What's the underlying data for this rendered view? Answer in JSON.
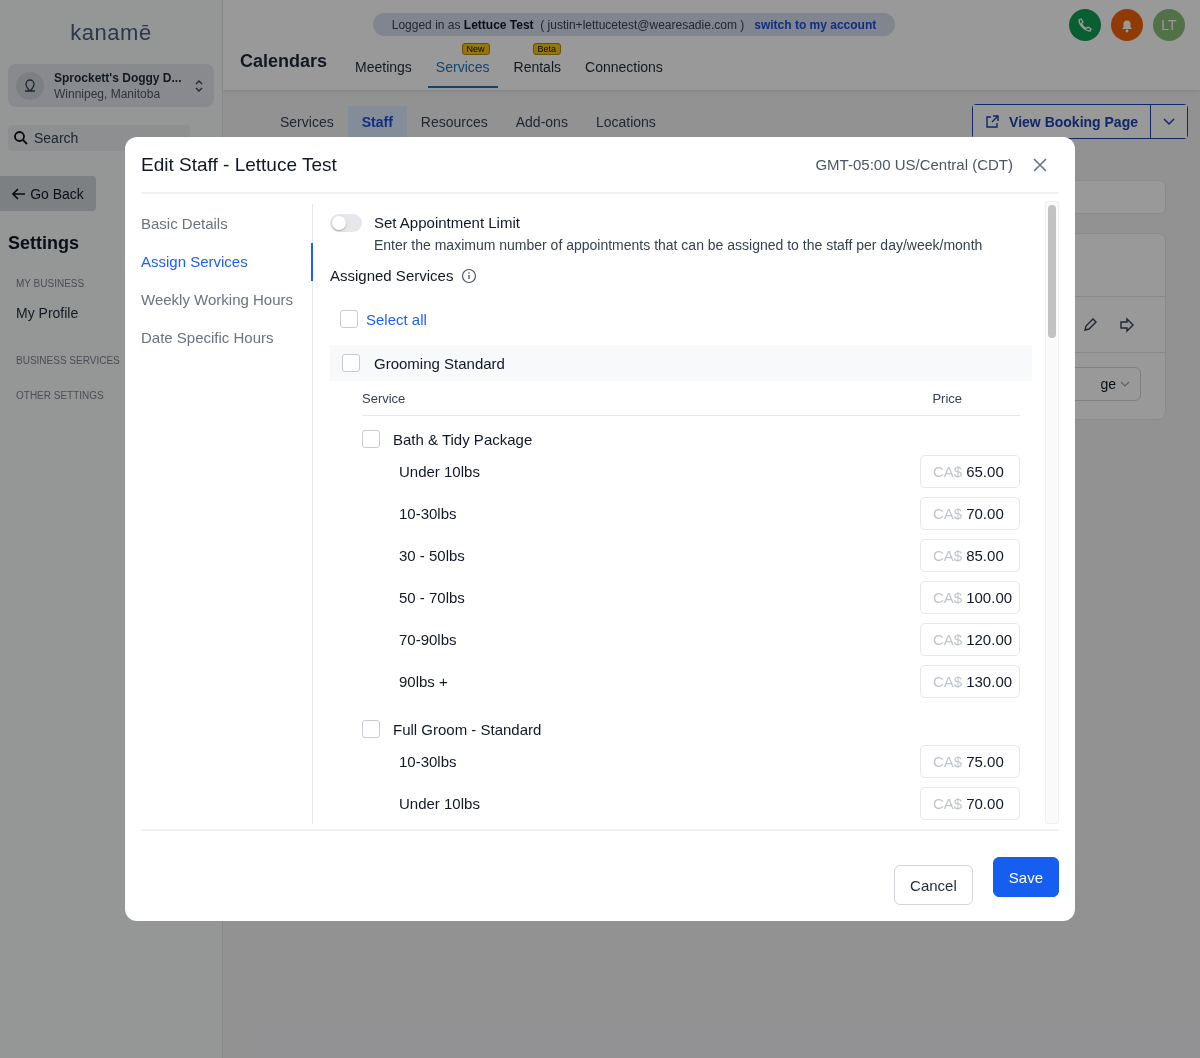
{
  "sidebar": {
    "logo": "kanamē",
    "location": {
      "name": "Sprockett's Doggy D...",
      "city": "Winnipeg, Manitoba"
    },
    "search": {
      "placeholder": "Search"
    },
    "back_button": "Go Back",
    "heading": "Settings",
    "items": [
      {
        "kind": "section",
        "label": "MY BUSINESS"
      },
      {
        "kind": "link",
        "label": "My Profile"
      },
      {
        "kind": "section",
        "label": "BUSINESS SERVICES"
      },
      {
        "kind": "section",
        "label": "OTHER SETTINGS"
      }
    ]
  },
  "banner": {
    "prefix": "Logged in as",
    "name": "Lettuce Test",
    "email": "( justin+lettucetest@wearesadie.com )",
    "link": "switch to my account"
  },
  "header": {
    "title": "Calendars",
    "avatar": "LT",
    "tabs": [
      {
        "label": "Meetings",
        "selected": false
      },
      {
        "label": "Services",
        "badge": "New",
        "selected": true
      },
      {
        "label": "Rentals",
        "badge": "Beta",
        "selected": false
      },
      {
        "label": "Connections",
        "selected": false
      }
    ]
  },
  "subtabs": [
    {
      "label": "Services",
      "selected": false
    },
    {
      "label": "Staff",
      "selected": true
    },
    {
      "label": "Resources",
      "selected": false
    },
    {
      "label": "Add-ons",
      "selected": false
    },
    {
      "label": "Locations",
      "selected": false
    }
  ],
  "view_booking_button": "View Booking Page",
  "card_select": "ge",
  "modal": {
    "title": "Edit Staff - Lettuce Test",
    "timezone": "GMT-05:00 US/Central (CDT)",
    "nav": [
      {
        "label": "Basic Details",
        "selected": false
      },
      {
        "label": "Assign Services",
        "selected": true
      },
      {
        "label": "Weekly Working Hours",
        "selected": false
      },
      {
        "label": "Date Specific Hours",
        "selected": false
      }
    ],
    "limit": {
      "label": "Set Appointment Limit",
      "on": false,
      "description": "Enter the maximum number of appointments that can be assigned to the staff per day/week/month"
    },
    "assigned_title": "Assigned Services",
    "select_all": {
      "label": "Select all",
      "checked": false
    },
    "groups": [
      {
        "name": "Grooming Standard",
        "checked": false,
        "columns": [
          "Service",
          "Price"
        ],
        "services": [
          {
            "name": "Bath & Tidy Package",
            "checked": false,
            "variants": [
              {
                "name": "Under 10lbs",
                "currency": "CA$",
                "price": "65.00"
              },
              {
                "name": "10-30lbs",
                "currency": "CA$",
                "price": "70.00"
              },
              {
                "name": "30 - 50lbs",
                "currency": "CA$",
                "price": "85.00"
              },
              {
                "name": "50 - 70lbs",
                "currency": "CA$",
                "price": "100.00"
              },
              {
                "name": "70-90lbs",
                "currency": "CA$",
                "price": "120.00"
              },
              {
                "name": "90lbs +",
                "currency": "CA$",
                "price": "130.00"
              }
            ]
          },
          {
            "name": "Full Groom - Standard",
            "checked": false,
            "variants": [
              {
                "name": "10-30lbs",
                "currency": "CA$",
                "price": "75.00"
              },
              {
                "name": "Under 10lbs",
                "currency": "CA$",
                "price": "70.00"
              }
            ]
          }
        ]
      }
    ],
    "buttons": [
      {
        "kind": "secondary",
        "label": "Cancel"
      },
      {
        "kind": "primary",
        "label": "Save"
      }
    ]
  }
}
